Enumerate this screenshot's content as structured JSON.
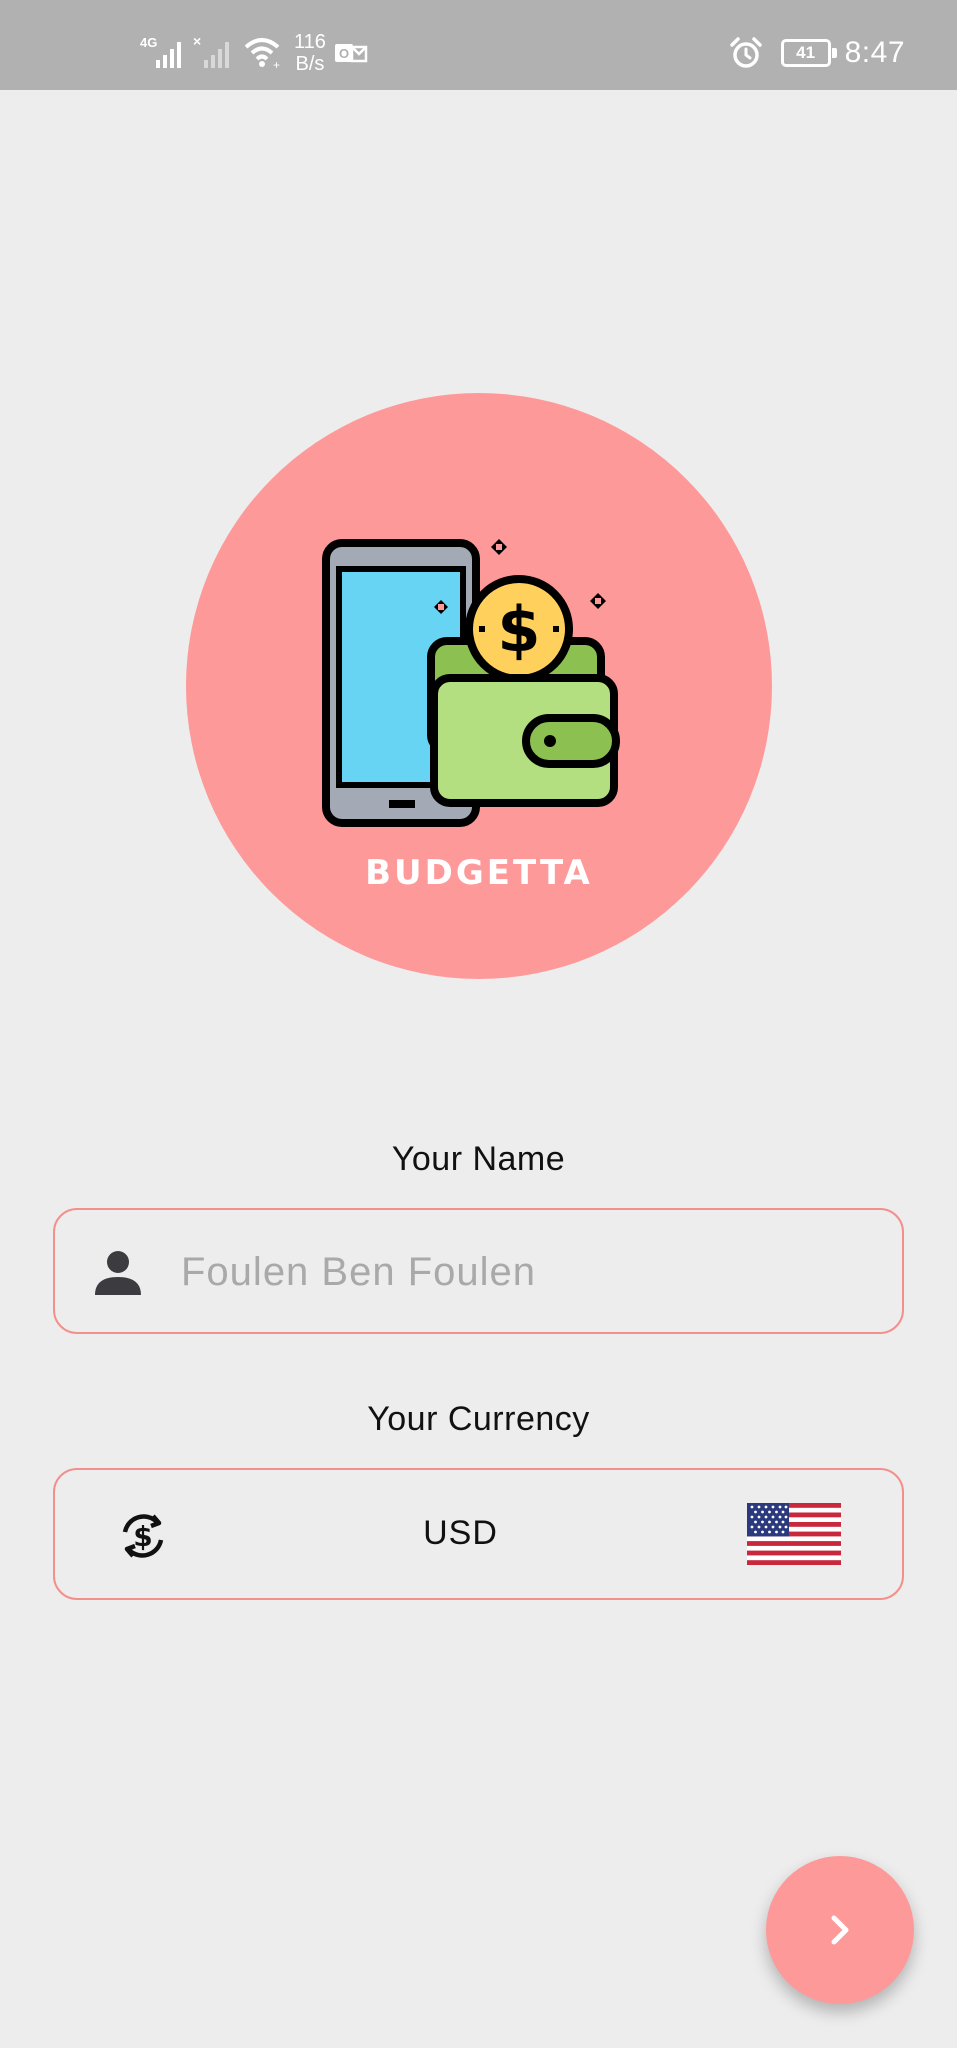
{
  "status_bar": {
    "network_label": "4G",
    "net_speed_value": "116",
    "net_speed_unit": "B/s",
    "battery_level": "41",
    "clock": "8:47"
  },
  "logo": {
    "brand_name": "BUDGETTA",
    "circle_color": "#fe9999"
  },
  "form": {
    "name_label": "Your Name",
    "name_placeholder": "Foulen Ben Foulen",
    "name_value": "",
    "currency_label": "Your Currency",
    "currency_code": "USD",
    "currency_flag": "us-flag-icon",
    "border_color": "#f2908c"
  },
  "fab": {
    "icon": "chevron-right-icon",
    "color": "#fe9999"
  }
}
